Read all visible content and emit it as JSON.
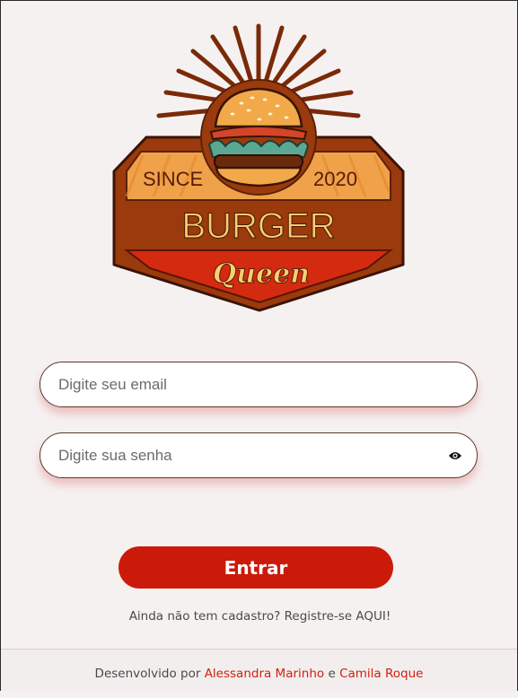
{
  "logo": {
    "since": "SINCE",
    "year": "2020",
    "brand": "BURGER",
    "script": "Queen"
  },
  "login": {
    "email_placeholder": "Digite seu email",
    "password_placeholder": "Digite sua senha",
    "submit_label": "Entrar"
  },
  "register": {
    "text": "Ainda não tem cadastro? Registre-se AQUI!"
  },
  "footer": {
    "prefix": "Desenvolvido por",
    "author1": "Alessandra Marinho",
    "conjunction": "e",
    "author2": "Camila Roque"
  },
  "colors": {
    "accent": "#cc1a0a",
    "logo_brown": "#9b3a0d",
    "background": "#f6f1f1"
  },
  "icons": [
    "burger-logo-icon",
    "eye-icon"
  ]
}
